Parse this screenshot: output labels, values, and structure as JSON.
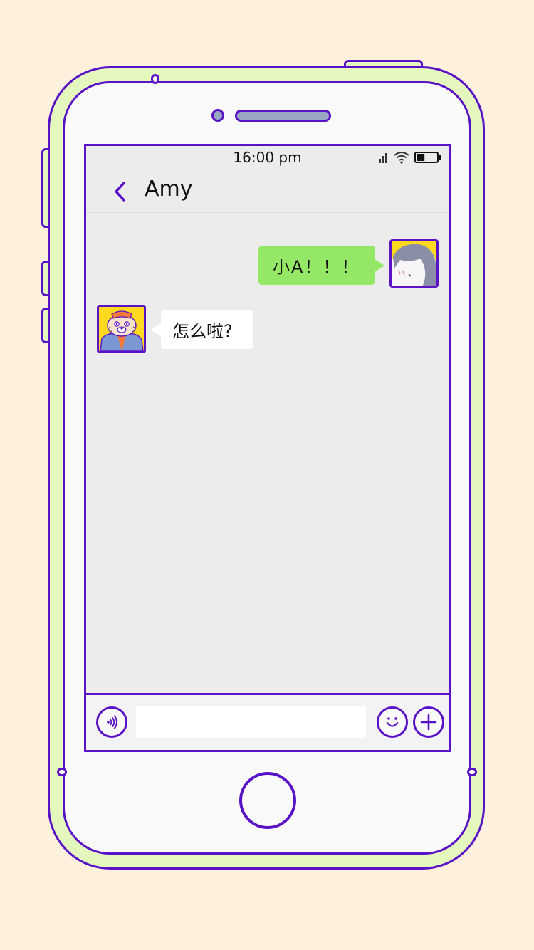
{
  "status_bar": {
    "time": "16:00 pm",
    "battery_level": 0.4
  },
  "nav": {
    "title": "Amy",
    "back_icon": "chevron-left-icon"
  },
  "messages": [
    {
      "direction": "outgoing",
      "text": "小A！！！"
    },
    {
      "direction": "incoming",
      "text": "怎么啦?"
    }
  ],
  "input_bar": {
    "voice_icon": "voice-icon",
    "emoji_icon": "smiley-icon",
    "add_icon": "plus-icon",
    "placeholder": ""
  },
  "colors": {
    "background": "#fdf1de",
    "frame": "#e4f7bd",
    "outline": "#5a12c6",
    "outgoing_bubble": "#94e865",
    "incoming_bubble": "#ffffff",
    "chat_background": "#ececed"
  }
}
